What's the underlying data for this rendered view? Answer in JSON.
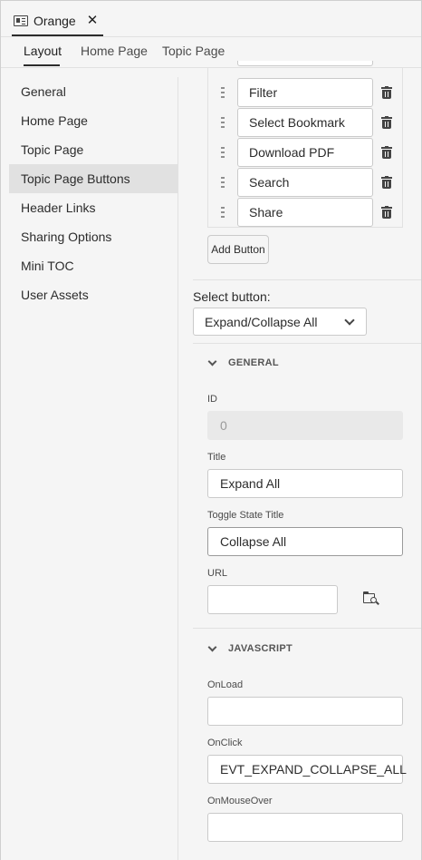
{
  "document": {
    "title": "Orange",
    "close_glyph": "✕",
    "icon": "document-icon"
  },
  "tabs": [
    "Layout",
    "Home Page",
    "Topic Page"
  ],
  "active_tab": "Layout",
  "nav": {
    "items": [
      "General",
      "Home Page",
      "Topic Page",
      "Topic Page Buttons",
      "Header Links",
      "Sharing Options",
      "Mini TOC",
      "User Assets"
    ],
    "active": "Topic Page Buttons"
  },
  "buttons_list": {
    "items": [
      "Filter",
      "Select Bookmark",
      "Download PDF",
      "Search",
      "Share"
    ],
    "add_label": "Add Button"
  },
  "select_button": {
    "label": "Select button:",
    "value": "Expand/Collapse All"
  },
  "general": {
    "heading": "GENERAL",
    "id_label": "ID",
    "id_value": "0",
    "title_label": "Title",
    "title_value": "Expand All",
    "toggle_label": "Toggle State Title",
    "toggle_value": "Collapse All",
    "url_label": "URL",
    "url_value": ""
  },
  "javascript": {
    "heading": "JAVASCRIPT",
    "onload_label": "OnLoad",
    "onload_value": "",
    "onclick_label": "OnClick",
    "onclick_value": "EVT_EXPAND_COLLAPSE_ALL",
    "onmouseover_label": "OnMouseOver",
    "onmouseover_value": ""
  },
  "colors": {
    "panel_bg": "#f5f5f5",
    "active_nav_bg": "#e1e1e1",
    "border": "#cacaca",
    "text": "#2c2c2c"
  }
}
